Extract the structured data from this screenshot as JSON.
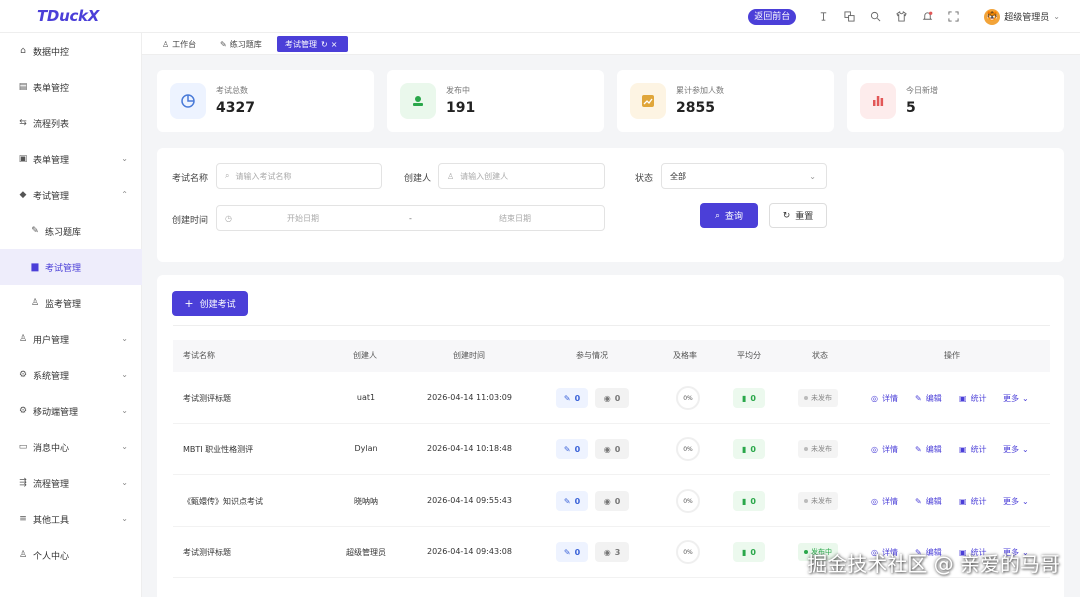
{
  "app": {
    "logo": "TDuckX"
  },
  "header": {
    "back_label": "返回前台",
    "user_name": "超级管理员",
    "icons": [
      "pin-icon",
      "translate-icon",
      "search-icon",
      "shirt-icon",
      "bell-icon",
      "fullscreen-icon"
    ]
  },
  "sidebar": {
    "items": [
      {
        "label": "数据中控",
        "icon": "home-icon"
      },
      {
        "label": "表单管控",
        "icon": "form-icon"
      },
      {
        "label": "流程列表",
        "icon": "flow-icon"
      },
      {
        "label": "表单管理",
        "icon": "form-manage-icon",
        "chevron": "down"
      },
      {
        "label": "考试管理",
        "icon": "graduation-icon",
        "chevron": "up"
      },
      {
        "label": "练习题库",
        "icon": "edit-icon",
        "sub": true
      },
      {
        "label": "考试管理",
        "icon": "doc-icon",
        "sub": true,
        "active": true
      },
      {
        "label": "监考管理",
        "icon": "proctor-icon",
        "sub": true
      },
      {
        "label": "用户管理",
        "icon": "user-icon",
        "chevron": "down"
      },
      {
        "label": "系统管理",
        "icon": "settings-icon",
        "chevron": "down"
      },
      {
        "label": "移动端管理",
        "icon": "mobile-icon",
        "chevron": "down"
      },
      {
        "label": "消息中心",
        "icon": "message-icon",
        "chevron": "down"
      },
      {
        "label": "流程管理",
        "icon": "process-icon",
        "chevron": "down"
      },
      {
        "label": "其他工具",
        "icon": "tools-icon",
        "chevron": "down"
      },
      {
        "label": "个人中心",
        "icon": "profile-icon"
      }
    ]
  },
  "tabs": [
    {
      "label": "工作台",
      "icon": "user-icon"
    },
    {
      "label": "练习题库",
      "icon": "edit-icon"
    },
    {
      "label": "考试管理",
      "icon": "refresh-icon",
      "active": true
    }
  ],
  "stats": [
    {
      "label": "考试总数",
      "value": "4327",
      "icon": "pie-icon",
      "color": "#4a7bd8",
      "bg": "#edf3ff"
    },
    {
      "label": "发布中",
      "value": "191",
      "icon": "upload-icon",
      "color": "#2aa74a",
      "bg": "#eaf8ec"
    },
    {
      "label": "累计参加人数",
      "value": "2855",
      "icon": "trend-icon",
      "color": "#e0a63a",
      "bg": "#fdf4e3"
    },
    {
      "label": "今日新增",
      "value": "5",
      "icon": "bar-icon",
      "color": "#e25757",
      "bg": "#fdecec"
    }
  ],
  "filter": {
    "name_label": "考试名称",
    "name_placeholder": "请输入考试名称",
    "creator_label": "创建人",
    "creator_placeholder": "请输入创建人",
    "status_label": "状态",
    "status_value": "全部",
    "time_label": "创建时间",
    "start_placeholder": "开始日期",
    "separator": "-",
    "end_placeholder": "结束日期",
    "query_label": "查询",
    "reset_label": "重置"
  },
  "table": {
    "create_label": "创建考试",
    "columns": [
      "考试名称",
      "创建人",
      "创建时间",
      "参与情况",
      "及格率",
      "平均分",
      "状态",
      "操作"
    ],
    "ops": {
      "detail": "详情",
      "edit": "编辑",
      "stats": "统计",
      "more": "更多"
    },
    "rows": [
      {
        "name": "考试测评标题",
        "creator": "uat1",
        "time": "2026-04-14 11:03:09",
        "submit": "0",
        "view": "0",
        "pass": "0%",
        "avg": "0",
        "status": "未发布"
      },
      {
        "name": "MBTI 职业性格测评",
        "creator": "Dylan",
        "time": "2026-04-14 10:18:48",
        "submit": "0",
        "view": "0",
        "pass": "0%",
        "avg": "0",
        "status": "未发布"
      },
      {
        "name": "《甄嬛传》知识点考试",
        "creator": "晓呐呐",
        "time": "2026-04-14 09:55:43",
        "submit": "0",
        "view": "0",
        "pass": "0%",
        "avg": "0",
        "status": "未发布"
      },
      {
        "name": "考试测评标题",
        "creator": "超级管理员",
        "time": "2026-04-14 09:43:08",
        "submit": "0",
        "view": "3",
        "pass": "0%",
        "avg": "0",
        "status": "发布中"
      }
    ]
  },
  "watermark": "掘金技术社区 @ 亲爱的马哥"
}
